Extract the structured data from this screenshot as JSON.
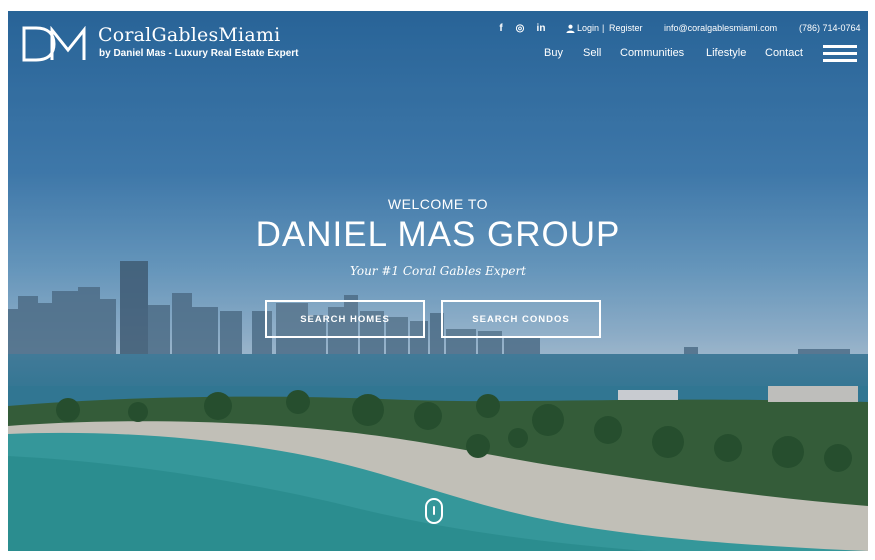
{
  "header": {
    "brand_name": "CoralGablesMiami",
    "brand_tagline": "by Daniel Mas - Luxury Real Estate Expert",
    "social": [
      "f",
      "◎",
      "in"
    ],
    "login": "Login",
    "separator": "|",
    "register": "Register",
    "email": "info@coralgablesmiami.com",
    "phone": "(786) 714-0764",
    "nav": [
      "Buy",
      "Sell",
      "Communities",
      "Lifestyle",
      "Contact"
    ]
  },
  "hero": {
    "welcome": "WELCOME TO",
    "headline": "DANIEL MAS GROUP",
    "tagline": "Your #1 Coral Gables Expert",
    "cta_homes": "SEARCH HOMES",
    "cta_condos": "SEARCH CONDOS"
  },
  "colors": {
    "sky_top": "#2f74ad",
    "water": "#3a8aa6",
    "lagoon": "#3fb3b0",
    "text": "#ffffff"
  },
  "icons": {
    "facebook": "facebook-icon",
    "instagram": "instagram-icon",
    "linkedin": "linkedin-icon",
    "user": "user-icon",
    "menu": "hamburger-menu-icon",
    "scroll": "scroll-mouse-icon"
  }
}
